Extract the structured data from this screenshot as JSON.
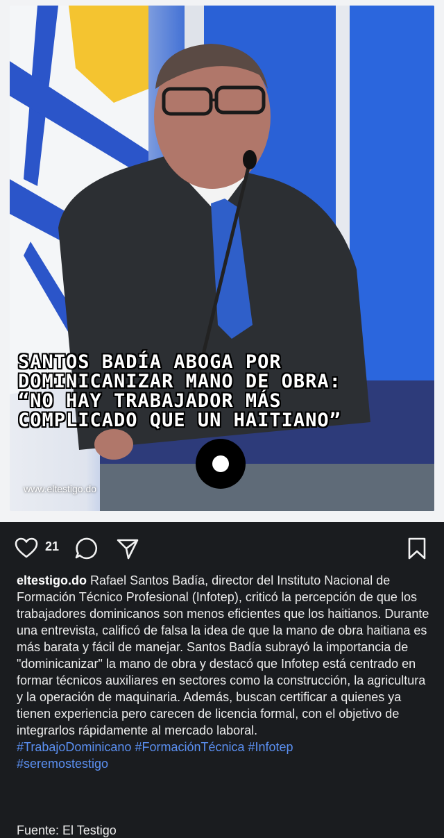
{
  "post": {
    "headline": {
      "line1": "SANTOS BADÍA ABOGA POR",
      "line2": "DOMINICANIZAR MANO DE OBRA:",
      "line3": "“NO HAY TRABAJADOR MÁS",
      "line4": "COMPLICADO QUE UN HAITIANO”"
    },
    "watermark": "www.eltestigo.do"
  },
  "actions": {
    "like_count": "21",
    "icons": [
      "heart-icon",
      "comment-icon",
      "share-icon",
      "bookmark-icon"
    ]
  },
  "caption": {
    "username": "eltestigo.do",
    "text": "Rafael Santos Badía, director del Instituto Nacional de Formación Técnico Profesional (Infotep), criticó la percepción de que los trabajadores dominicanos son menos eficientes que los haitianos. Durante una entrevista, calificó de falsa la idea de que la mano de obra haitiana es más barata y fácil de manejar. Santos Badía subrayó la importancia de \"dominicanizar\" la mano de obra y destacó que Infotep está centrado en formar técnicos auxiliares en sectores como la construcción, la agricultura y la operación de maquinaria. Además, buscan certificar a quienes ya tienen experiencia pero carecen de licencia formal, con el objetivo de integrarlos rápidamente al mercado laboral.",
    "hashtags": [
      "#TrabajoDominicano",
      "#FormaciónTécnica",
      "#Infotep",
      "#seremostestigo"
    ],
    "source": "Fuente: El Testigo"
  },
  "colors": {
    "background": "#1a1c1f",
    "hashtag": "#5b90f2",
    "text": "#ececec"
  }
}
